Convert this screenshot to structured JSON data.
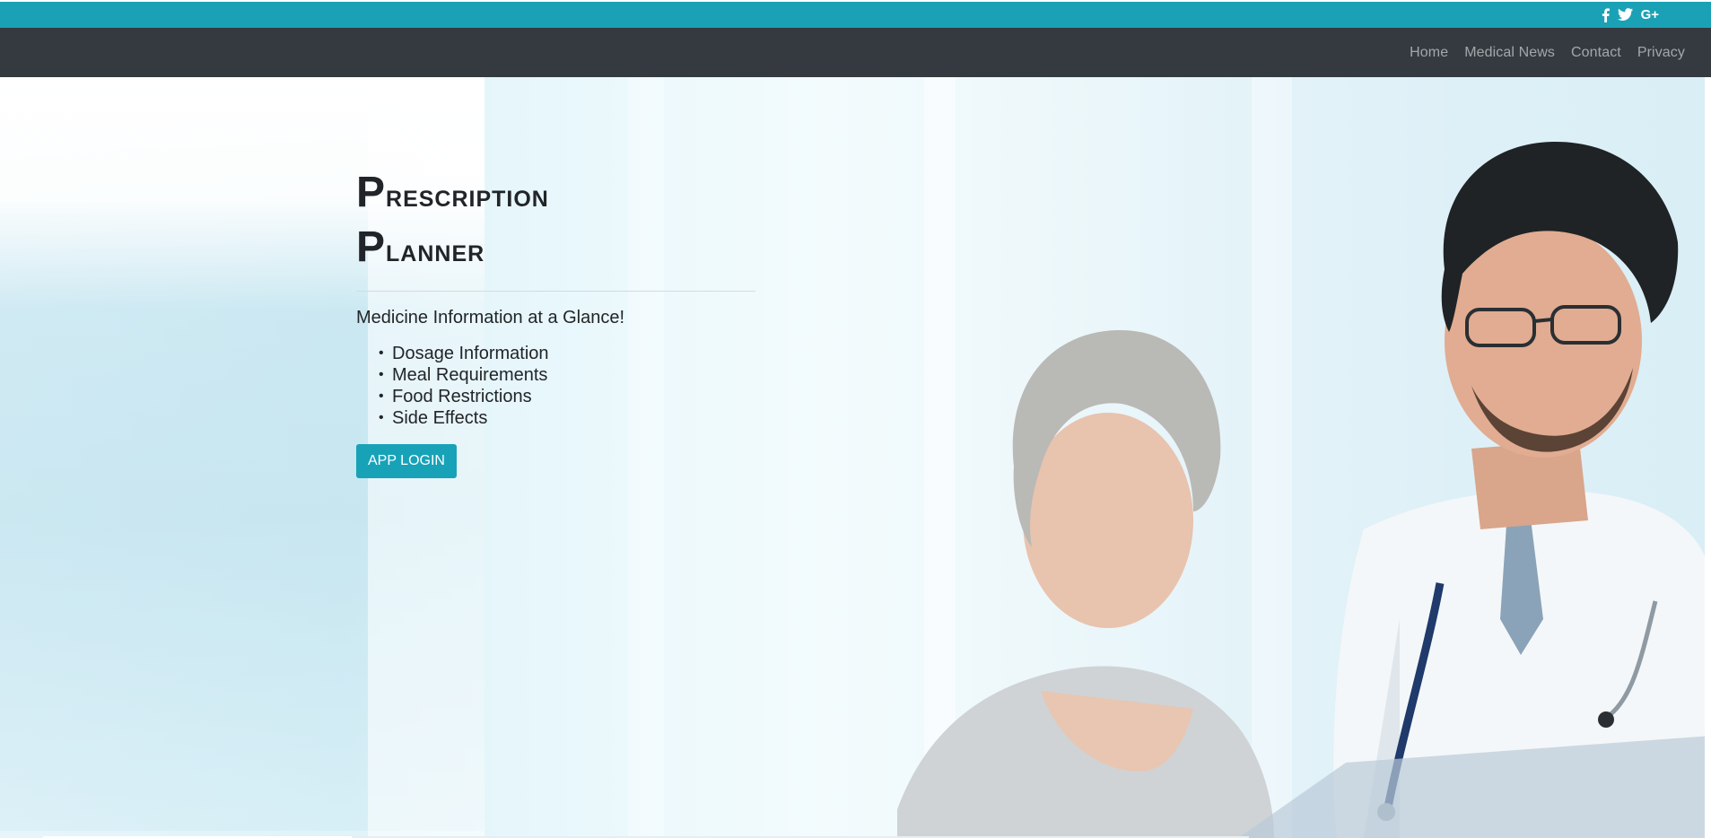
{
  "social": {
    "facebook_icon": "facebook-icon",
    "twitter_icon": "twitter-icon",
    "googleplus_icon": "google-plus-icon",
    "googleplus_label": "G+"
  },
  "nav": {
    "items": [
      {
        "label": "Home"
      },
      {
        "label": "Medical News"
      },
      {
        "label": "Contact"
      },
      {
        "label": "Privacy"
      }
    ]
  },
  "hero": {
    "title_line1_first": "P",
    "title_line1_rest": "rescription",
    "title_line2_first": "P",
    "title_line2_rest": "lanner",
    "tagline": "Medicine Information at a Glance!",
    "features": [
      "Dosage Information",
      "Meal Requirements",
      "Food Restrictions",
      "Side Effects"
    ],
    "login_label": "APP LOGIN"
  },
  "colors": {
    "accent": "#17a2b8",
    "top_strip": "#1ba1b5",
    "navbar": "#343a40",
    "text": "#212529"
  }
}
